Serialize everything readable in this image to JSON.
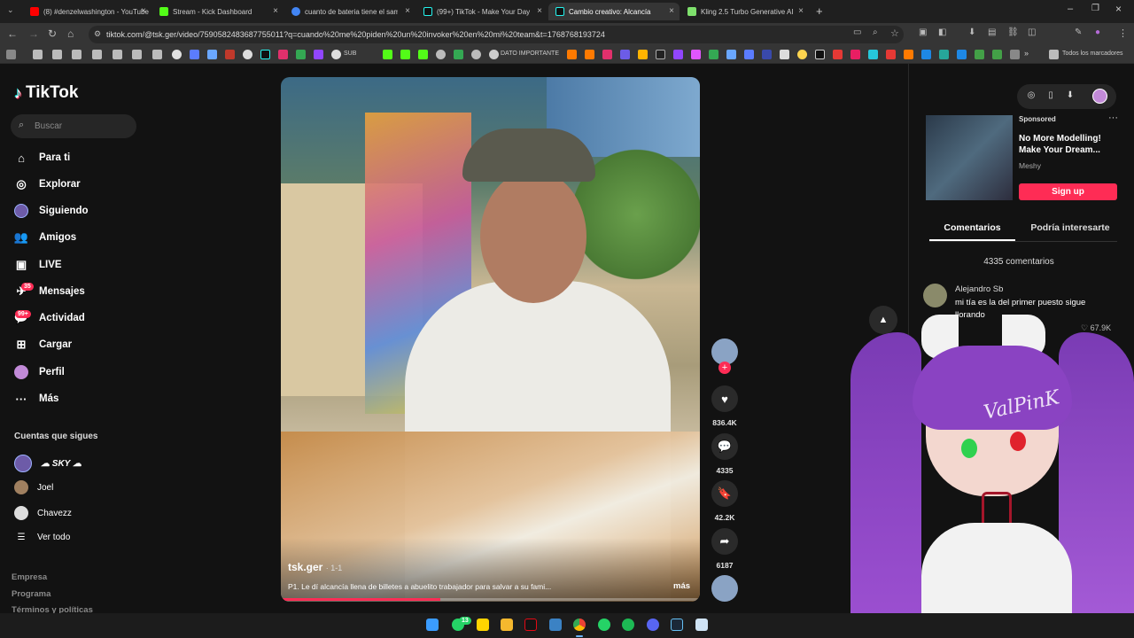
{
  "browser": {
    "tabs": [
      {
        "label": "(8) #denzelwashington - YouTube",
        "color": "#ff0000"
      },
      {
        "label": "Stream - Kick Dashboard",
        "color": "#53fc18"
      },
      {
        "label": "cuanto de bateria tiene el samsung",
        "color": "#4285f4"
      },
      {
        "label": "(99+) TikTok - Make Your Day",
        "color": "#25f4ee"
      },
      {
        "label": "Cambio creativo: Alcancía llena",
        "color": "#25f4ee"
      },
      {
        "label": "Kling 2.5 Turbo Generative AI M",
        "color": "#7ee06c"
      }
    ],
    "new_tab": "+",
    "url": "tiktok.com/@tsk.ger/video/7590582483687755011?q=cuando%20me%20piden%20un%20invoker%20en%20mi%20team&t=1768768193724",
    "bookmarks": {
      "sub": "SUB",
      "dato": "DATO IMPORTANTE",
      "all": "Todos los marcadores"
    }
  },
  "tiktok": {
    "logo": "TikTok",
    "search_placeholder": "Buscar",
    "nav": [
      {
        "label": "Para ti",
        "icon": "home-icon"
      },
      {
        "label": "Explorar",
        "icon": "compass-icon"
      },
      {
        "label": "Siguiendo",
        "icon": "following-icon"
      },
      {
        "label": "Amigos",
        "icon": "friends-icon"
      },
      {
        "label": "LIVE",
        "icon": "live-icon"
      },
      {
        "label": "Mensajes",
        "icon": "messages-icon"
      },
      {
        "label": "Actividad",
        "icon": "activity-icon"
      },
      {
        "label": "Cargar",
        "icon": "upload-icon"
      },
      {
        "label": "Perfil",
        "icon": "profile-icon"
      },
      {
        "label": "Más",
        "icon": "more-icon"
      }
    ],
    "badges": {
      "mensajes": "35",
      "actividad": "99+"
    },
    "following_title": "Cuentas que sigues",
    "following": [
      {
        "name": "☁ SKY ☁"
      },
      {
        "name": "Joel"
      },
      {
        "name": "Chavezz"
      }
    ],
    "see_all": "Ver todo",
    "footer": [
      "Empresa",
      "Programa",
      "Términos y políticas"
    ]
  },
  "video": {
    "author": "tsk.ger",
    "date": "· 1-1",
    "caption": "P1. Le dí alcancía llena de billetes a abuelito trabajador para salvar a su fami...",
    "more": "más",
    "likes": "836.4K",
    "comments": "4335",
    "saves": "42.2K",
    "shares": "6187"
  },
  "panel": {
    "sponsored_label": "Sponsored",
    "ad_title": "No More Modelling! Make Your Dream...",
    "ad_brand": "Meshy",
    "ad_button": "Sign up",
    "tabs": [
      "Comentarios",
      "Podría interesarte"
    ],
    "comment_count": "4335 comentarios",
    "comment": {
      "user": "Alejandro Sb",
      "text": "mi tía es la del primer puesto sigue llorando",
      "likes": "67.9K"
    }
  },
  "overlay": {
    "watermark": "ValPinK"
  },
  "taskbar": {
    "whatsapp_badge": "13"
  }
}
